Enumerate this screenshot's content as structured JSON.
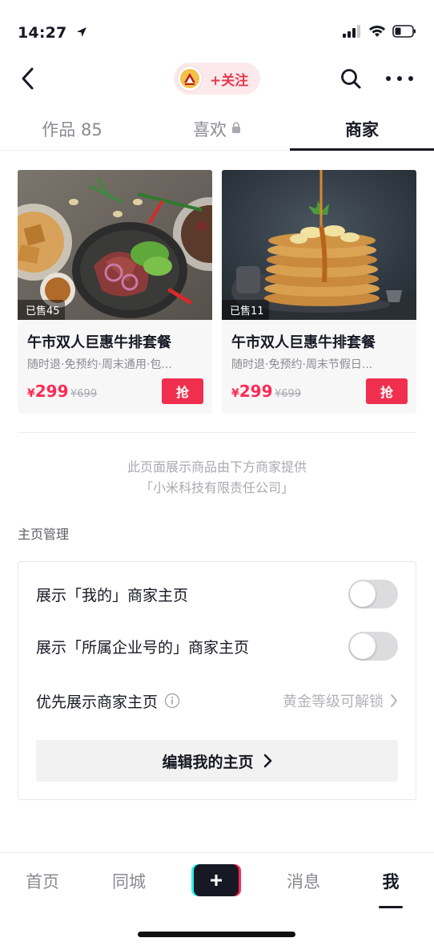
{
  "status_bar": {
    "time": "14:27"
  },
  "nav": {
    "follow_label": "+关注",
    "avatar_alt": "brand-logo"
  },
  "tabs": [
    {
      "label": "作品 85",
      "active": false
    },
    {
      "label": "喜欢",
      "active": false,
      "locked": true
    },
    {
      "label": "商家",
      "active": true
    }
  ],
  "products": [
    {
      "sold": "已售45",
      "title": "午市双人巨惠牛排套餐",
      "subtitle": "随时退·免预约·周末通用·包...",
      "price_currency": "¥",
      "price": "299",
      "original_price": "¥699",
      "buy_label": "抢"
    },
    {
      "sold": "已售11",
      "title": "午市双人巨惠牛排套餐",
      "subtitle": "随时退·免预约·周末节假日...",
      "price_currency": "¥",
      "price": "299",
      "original_price": "¥699",
      "buy_label": "抢"
    }
  ],
  "provider": {
    "line1": "此页面展示商品由下方商家提供",
    "line2": "「小米科技有限责任公司」"
  },
  "management": {
    "title": "主页管理",
    "rows": [
      {
        "label": "展示「我的」商家主页",
        "toggle_on": false
      },
      {
        "label": "展示「所属企业号的」商家主页",
        "toggle_on": false
      }
    ],
    "priority_label": "优先展示商家主页",
    "priority_hint": "黄金等级可解锁",
    "edit_label": "编辑我的主页"
  },
  "bottom_nav": [
    {
      "label": "首页",
      "active": false
    },
    {
      "label": "同城",
      "active": false
    },
    {
      "label": "消息",
      "active": false
    },
    {
      "label": "我",
      "active": true
    }
  ],
  "colors": {
    "accent": "#fe2c55",
    "buy_button": "#f02f4e",
    "follow_bg": "#fbe9eb",
    "text_primary": "#161823",
    "text_secondary": "#8a8b91"
  }
}
